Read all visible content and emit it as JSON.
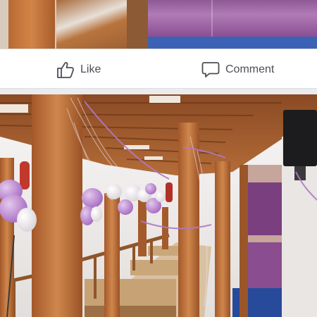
{
  "action_bar": {
    "like_label": "Like",
    "comment_label": "Comment",
    "like_icon": "thumbs-up-icon",
    "comment_icon": "comment-bubble-icon"
  },
  "colors": {
    "text": "#4b4f56",
    "bar_bg": "#ffffff",
    "page_bg": "#e9ebee"
  }
}
